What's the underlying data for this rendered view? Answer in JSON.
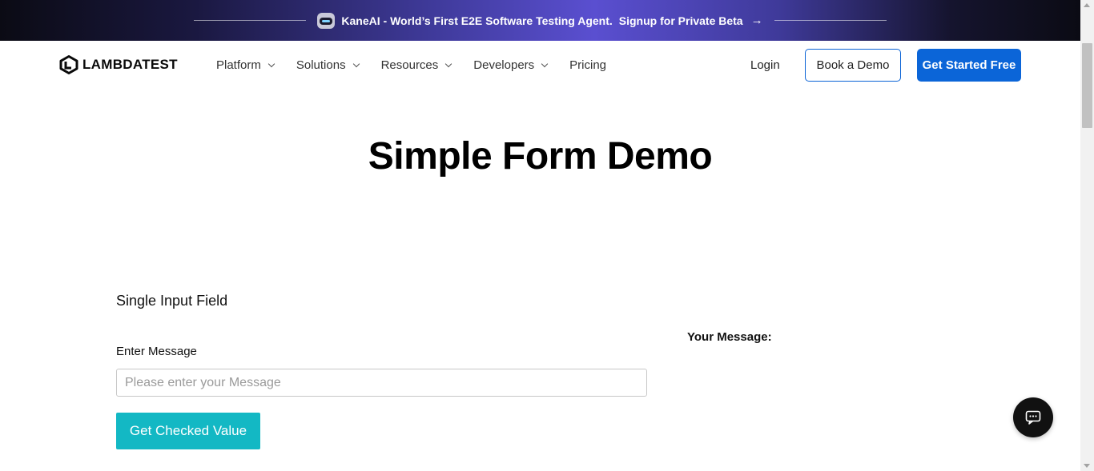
{
  "banner": {
    "icon": "kaneai-robot-icon",
    "text": "KaneAI - World’s First E2E Software Testing Agent.",
    "cta": "Signup for Private Beta",
    "arrow": "→",
    "gradient_color": "#5a4fd0"
  },
  "nav": {
    "logo_text": "LAMBDATEST",
    "menu": [
      {
        "label": "Platform",
        "has_dropdown": true
      },
      {
        "label": "Solutions",
        "has_dropdown": true
      },
      {
        "label": "Resources",
        "has_dropdown": true
      },
      {
        "label": "Developers",
        "has_dropdown": true
      },
      {
        "label": "Pricing",
        "has_dropdown": false
      }
    ],
    "login_label": "Login",
    "book_demo_label": "Book a Demo",
    "get_started_label": "Get Started Free",
    "accent_color": "#0b65d8"
  },
  "main": {
    "title": "Simple Form Demo",
    "section_title": "Single Input Field",
    "field_label": "Enter Message",
    "input": {
      "value": "",
      "placeholder": "Please enter your Message"
    },
    "button_label": "Get Checked Value",
    "button_color": "#13b8c4",
    "result_label": "Your Message:"
  },
  "chat_widget": {
    "icon": "chat-bubble-icon"
  }
}
